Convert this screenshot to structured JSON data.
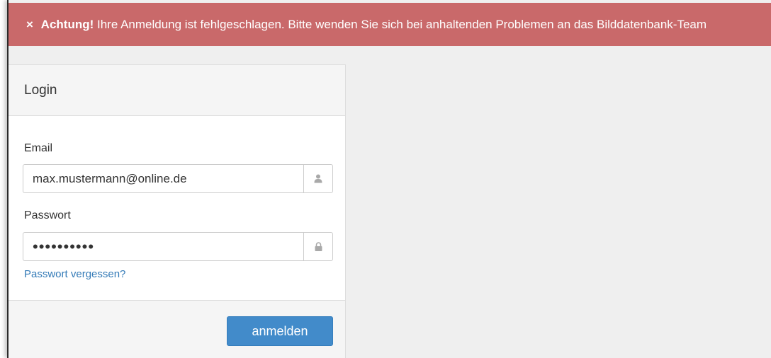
{
  "alert": {
    "close_symbol": "×",
    "title": "Achtung!",
    "message": "Ihre Anmeldung ist fehlgeschlagen. Bitte wenden Sie sich bei anhaltenden Problemen an das Bilddatenbank-Team",
    "background_color": "#c9696a"
  },
  "login": {
    "heading": "Login",
    "email_label": "Email",
    "email_value": "max.mustermann@online.de",
    "email_icon": "user-icon",
    "password_label": "Passwort",
    "password_value": "••••••••••",
    "password_icon": "lock-icon",
    "forgot_link": "Passwort vergessen?",
    "submit_label": "anmelden",
    "accent_color": "#428bca",
    "link_color": "#337ab7"
  }
}
